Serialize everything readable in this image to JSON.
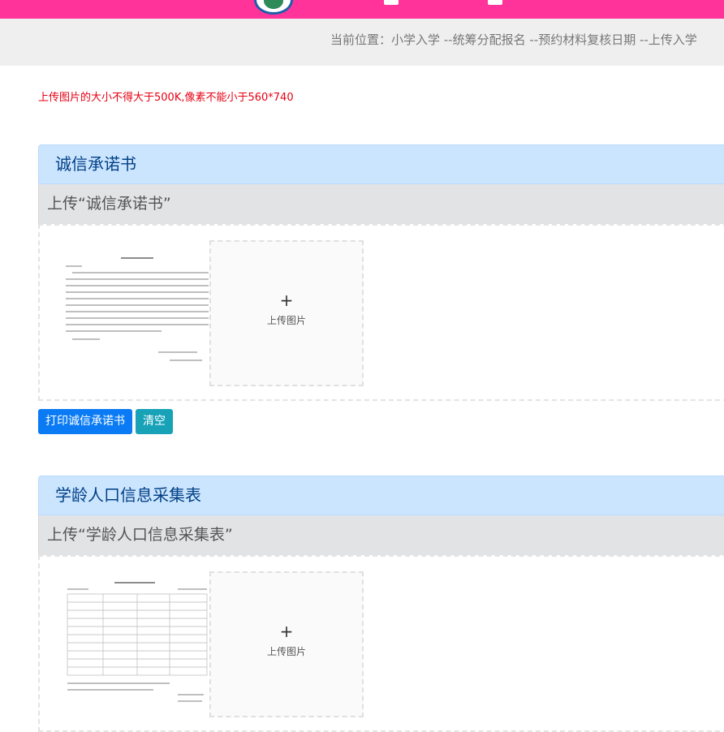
{
  "header": {
    "logo_icon": "school-emblem-icon",
    "brand_color": "#ff3399"
  },
  "breadcrumb": {
    "text": "当前位置：小学入学 --统筹分配报名 --预约材料复核日期 --上传入学"
  },
  "notice": "上传图片的大小不得大于500K,像素不能小于560*740",
  "sections": [
    {
      "title": "诚信承诺书",
      "subtitle": "上传“诚信承诺书”",
      "upload_plus": "+",
      "upload_label": "上传图片"
    },
    {
      "title": "学龄人口信息采集表",
      "subtitle": "上传“学龄人口信息采集表”",
      "upload_plus": "+",
      "upload_label": "上传图片"
    }
  ],
  "buttons": {
    "print": "打印诚信承诺书",
    "clear": "清空"
  },
  "colors": {
    "accent": "#0a7bf5",
    "info": "#17a2b8",
    "notice": "#e60012"
  }
}
